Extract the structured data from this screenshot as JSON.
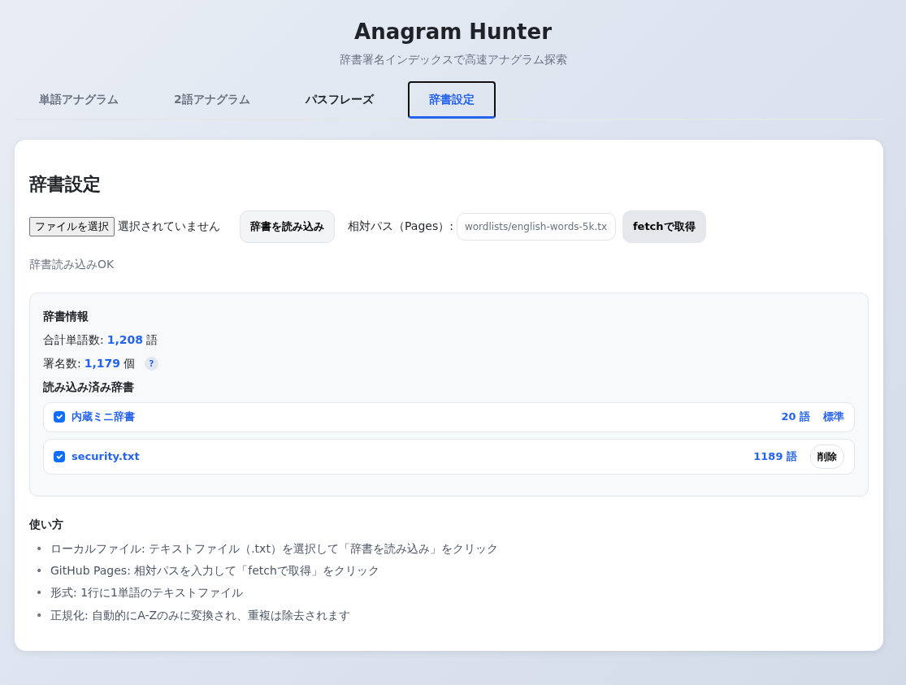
{
  "header": {
    "title": "Anagram Hunter",
    "subtitle": "辞書署名インデックスで高速アナグラム探索"
  },
  "tabs": [
    {
      "label": "単語アナグラム",
      "selected": false,
      "hovered": false
    },
    {
      "label": "2語アナグラム",
      "selected": false,
      "hovered": false
    },
    {
      "label": "パスフレーズ",
      "selected": false,
      "hovered": true
    },
    {
      "label": "辞書設定",
      "selected": true,
      "hovered": false
    }
  ],
  "panel": {
    "title": "辞書設定",
    "file_button": "ファイルを選択",
    "file_status": "選択されていません",
    "load_button": "辞書を読み込み",
    "path_label": "相対パス（Pages）:",
    "path_value": "wordlists/english-words-5k.tx",
    "fetch_button": "fetchで取得",
    "status": "辞書読み込みOK",
    "info": {
      "title": "辞書情報",
      "stats": [
        {
          "label": "合計単語数:",
          "value": "1,208",
          "unit": "語"
        },
        {
          "label": "署名数:",
          "value": "1,179",
          "unit": "個",
          "help": "?"
        }
      ],
      "loaded_title": "読み込み済み辞書",
      "dictionaries": [
        {
          "name": "内蔵ミニ辞書",
          "checked": true,
          "count": "20 語",
          "action": {
            "kind": "tag",
            "label": "標準"
          }
        },
        {
          "name": "security.txt",
          "checked": true,
          "count": "1189 語",
          "action": {
            "kind": "button",
            "label": "削除"
          }
        }
      ]
    },
    "usage": {
      "title": "使い方",
      "items": [
        {
          "marker": "•",
          "text": "ローカルファイル: テキストファイル（.txt）を選択して「辞書を読み込み」をクリック"
        },
        {
          "marker": "•",
          "text": "GitHub Pages: 相対パスを入力して「fetchで取得」をクリック"
        },
        {
          "marker": "•",
          "text": "形式: 1行に1単語のテキストファイル"
        },
        {
          "marker": "•",
          "text": "正規化: 自動的にA-Zのみに変換され、重複は除去されます"
        }
      ]
    }
  }
}
